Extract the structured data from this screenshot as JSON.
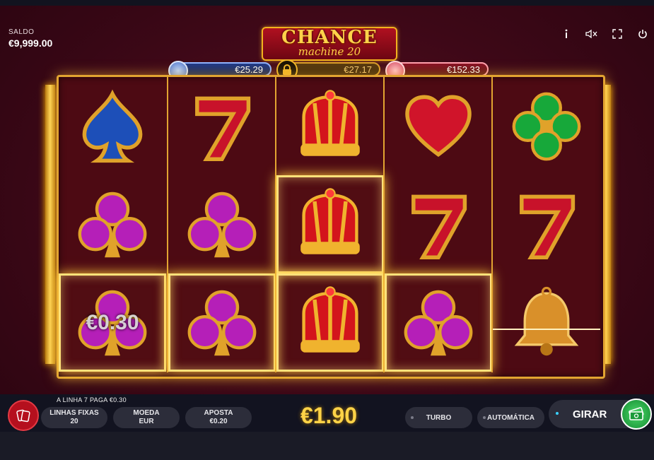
{
  "balance": {
    "label": "SALDO",
    "value": "€9,999.00"
  },
  "header_icons": [
    "info-icon",
    "sound-muted-icon",
    "fullscreen-icon",
    "power-icon"
  ],
  "logo": {
    "line1": "CHANCE",
    "line2": "machine 20"
  },
  "jackpots": [
    {
      "name": "blue",
      "value": "€25.29",
      "color": "#8fb3ff"
    },
    {
      "name": "gold",
      "value": "€27.17",
      "color": "#d89c2a",
      "locked": true
    },
    {
      "name": "red",
      "value": "€152.33",
      "color": "#ff9fae"
    }
  ],
  "reels": [
    [
      "blue-spade",
      "purple-club",
      "purple-club"
    ],
    [
      "red-seven",
      "purple-club",
      "purple-club"
    ],
    [
      "crown",
      "crown",
      "crown"
    ],
    [
      "red-heart",
      "red-seven",
      "purple-club"
    ],
    [
      "green-clover",
      "red-seven",
      "golden-bell"
    ]
  ],
  "winning_cells": [
    [
      2,
      1
    ],
    [
      2,
      2
    ],
    [
      1,
      0
    ],
    [
      2,
      0
    ],
    [
      2,
      3
    ]
  ],
  "win_amount": "€0.30",
  "line_pays": "A LINHA 7 PAGA €0.30",
  "controls": {
    "lines": {
      "label": "LINHAS FIXAS",
      "value": "20"
    },
    "coin": {
      "label": "MOEDA",
      "value": "EUR"
    },
    "bet": {
      "label": "APOSTA",
      "value": "€0.20"
    },
    "total_bet": "€1.90",
    "turbo": "TURBO",
    "auto": "AUTOMÁTICA",
    "spin": "GIRAR"
  }
}
